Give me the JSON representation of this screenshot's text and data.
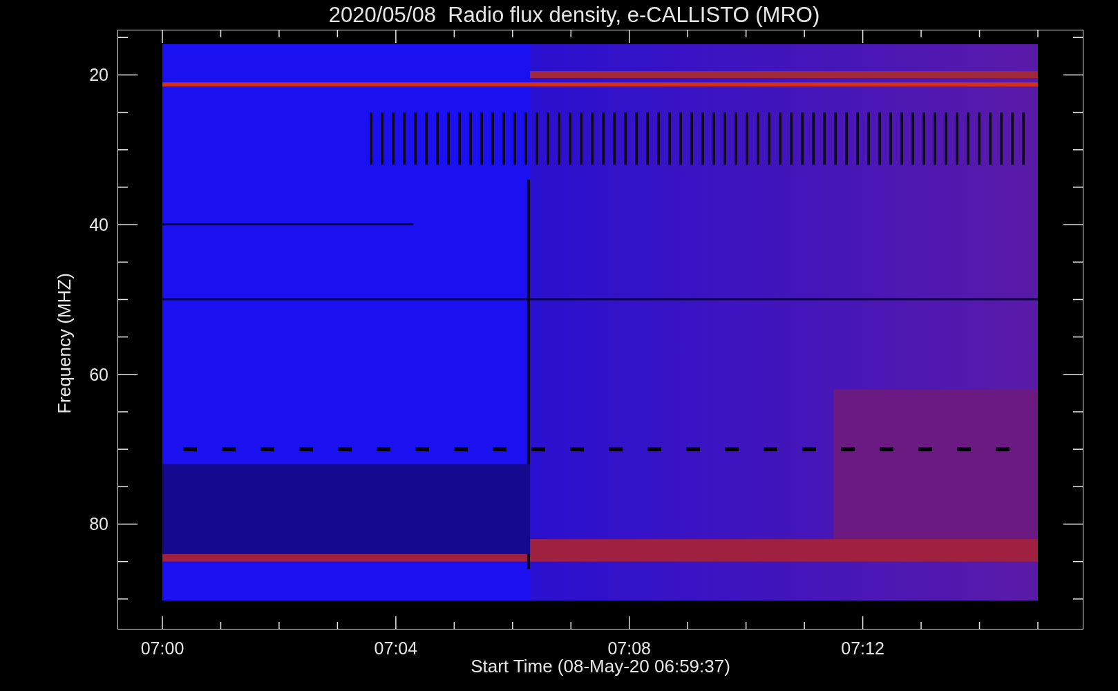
{
  "title": "2020/05/08  Radio flux density, e-CALLISTO (MRO)",
  "y_axis": {
    "label": "Frequency (MHZ)",
    "ticks": [
      "20",
      "40",
      "60",
      "80"
    ]
  },
  "x_axis": {
    "label": "Start Time (08-May-20 06:59:37)",
    "ticks": [
      "07:00",
      "07:04",
      "07:08",
      "07:12"
    ]
  }
}
